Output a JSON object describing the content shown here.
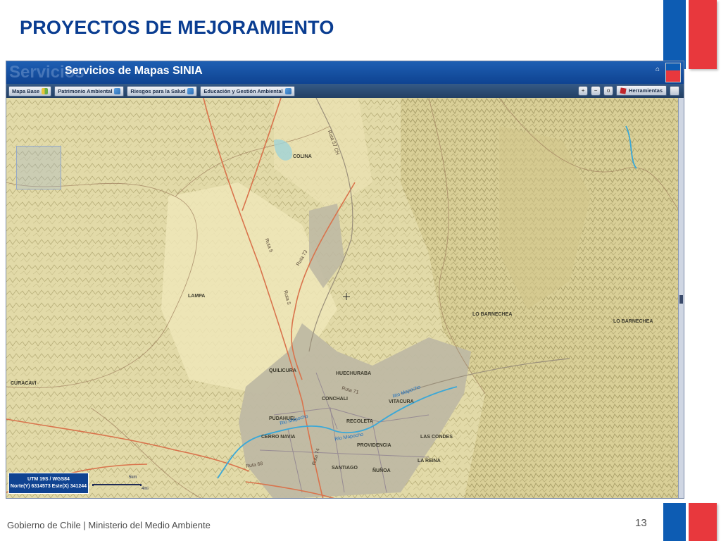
{
  "slide": {
    "title": "PROYECTOS DE MEJORAMIENTO",
    "footer": "Gobierno de Chile | Ministerio del Medio Ambiente",
    "page_number": "13"
  },
  "app": {
    "ghost_title": "Servicios",
    "title": "Servicios de Mapas SINIA",
    "menu": [
      {
        "label": "Mapa Base",
        "icon": "grid-icon"
      },
      {
        "label": "Patrimonio Ambiental",
        "icon": "layers-icon"
      },
      {
        "label": "Riesgos para la Salud",
        "icon": "layers-icon"
      },
      {
        "label": "Educación y Gestión Ambiental",
        "icon": "layers-icon"
      }
    ],
    "tools_label": "Herramientas",
    "zoom_in": "+",
    "zoom_out": "−",
    "zoom_reset": "o"
  },
  "map": {
    "places": [
      "COLINA",
      "LAMPA",
      "LO BARNECHEA",
      "LO BARNECHEA",
      "QUILICURA",
      "HUECHURABA",
      "CURACAVI",
      "CONCHALI",
      "VITACURA",
      "RECOLETA",
      "PUDAHUEL",
      "CERRO NAVIA",
      "PROVIDENCIA",
      "LAS CONDES",
      "SANTIAGO",
      "ÑUÑOA",
      "LA REINA"
    ],
    "rivers": [
      "Rio Mapocho",
      "Rio Mapocho",
      "Rio Mapocho"
    ],
    "routes": [
      "Ruta 57 CH",
      "Ruta 5",
      "Ruta 73",
      "Ruta 5",
      "Ruta 68",
      "Ruta 74",
      "Ruta 71"
    ],
    "colors": {
      "relief": "#e3dcaa",
      "urban": "#bfb9a3",
      "road": "#d9734c",
      "river": "#3aa8d8",
      "header": "#1257aa"
    }
  },
  "coords": {
    "system": "UTM 19S / WGS84",
    "value": "Norte(Y) 6314573 Este(X) 341244"
  },
  "scale": {
    "label_top": "5km",
    "label_bottom": "4mi"
  }
}
